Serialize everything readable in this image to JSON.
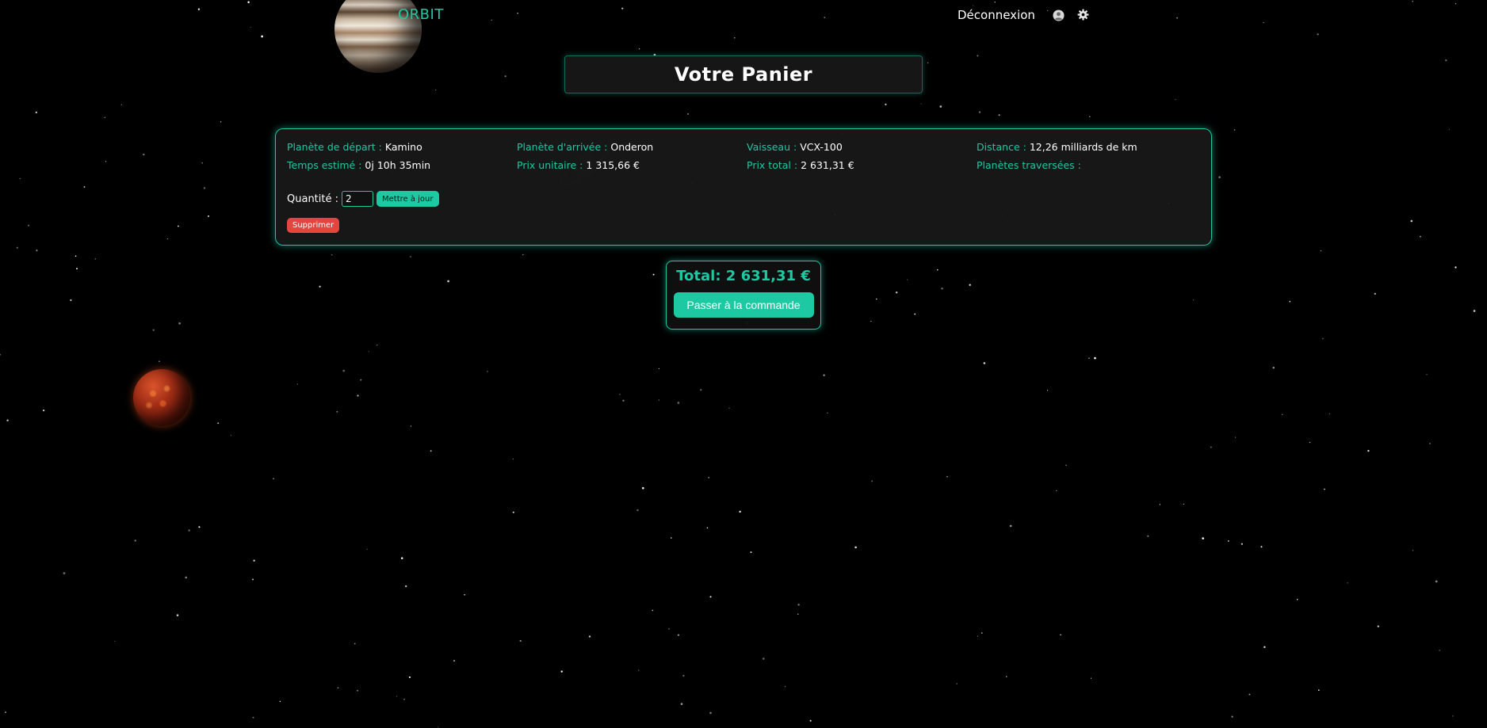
{
  "header": {
    "brand": "ORBIT",
    "logout_label": "Déconnexion",
    "user_icon": "user-icon",
    "settings_icon": "gear-icon"
  },
  "page": {
    "title": "Votre Panier"
  },
  "cart_item": {
    "departure_label": "Planète de départ :",
    "departure_value": "Kamino",
    "arrival_label": "Planète d'arrivée :",
    "arrival_value": "Onderon",
    "ship_label": "Vaisseau :",
    "ship_value": "VCX-100",
    "distance_label": "Distance :",
    "distance_value": "12,26 milliards de km",
    "time_label": "Temps estimé :",
    "time_value": "0j 10h 35min",
    "unit_price_label": "Prix unitaire :",
    "unit_price_value": "1 315,66 €",
    "total_price_label": "Prix total :",
    "total_price_value": "2 631,31 €",
    "planets_crossed_label": "Planètes traversées :",
    "planets_crossed_value": "",
    "quantity_label": "Quantité :",
    "quantity_value": "2",
    "update_label": "Mettre à jour",
    "delete_label": "Supprimer"
  },
  "summary": {
    "total_text": "Total: 2 631,31 €",
    "checkout_label": "Passer à la commande"
  },
  "colors": {
    "accent": "#1cc9a3",
    "background": "#000000",
    "danger": "#e2463f",
    "card": "#181818"
  }
}
